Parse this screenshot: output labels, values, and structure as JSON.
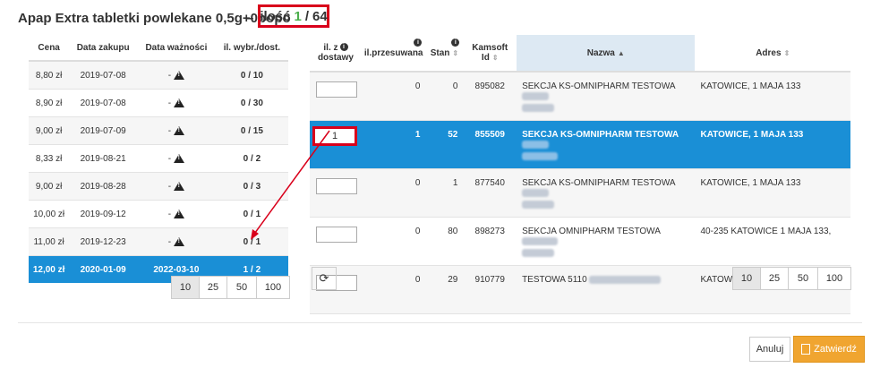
{
  "header": {
    "product": "Apap Extra tabletki powlekane 0,5g+0popo",
    "dash": "–",
    "qty_label": "ilość",
    "qty_selected": "1",
    "qty_sep": "/",
    "qty_total": "64"
  },
  "left": {
    "headers": [
      "Cena",
      "Data zakupu",
      "Data ważności",
      "il. wybr./dost."
    ],
    "rows": [
      {
        "price": "8,80 zł",
        "date": "2019-07-08",
        "exp": "-",
        "qty": "0 / 10"
      },
      {
        "price": "8,90 zł",
        "date": "2019-07-08",
        "exp": "-",
        "qty": "0 / 30"
      },
      {
        "price": "9,00 zł",
        "date": "2019-07-09",
        "exp": "-",
        "qty": "0 / 15"
      },
      {
        "price": "8,33 zł",
        "date": "2019-08-21",
        "exp": "-",
        "qty": "0 / 2"
      },
      {
        "price": "9,00 zł",
        "date": "2019-08-28",
        "exp": "-",
        "qty": "0 / 3"
      },
      {
        "price": "10,00 zł",
        "date": "2019-09-12",
        "exp": "-",
        "qty": "0 / 1"
      },
      {
        "price": "11,00 zł",
        "date": "2019-12-23",
        "exp": "-",
        "qty": "0 / 1"
      },
      {
        "price": "12,00 zł",
        "date": "2020-01-09",
        "exp": "2022-03-10",
        "qty": "1 / 2"
      }
    ],
    "pager": [
      "10",
      "25",
      "50",
      "100"
    ]
  },
  "right": {
    "headers": {
      "il_z_line1": "il. z",
      "il_z_line2": "dostawy",
      "przes": "il.przesuwana",
      "stan": "Stan",
      "kamsoft_line1": "Kamsoft",
      "kamsoft_line2": "Id",
      "nazwa": "Nazwa",
      "adres": "Adres"
    },
    "rows": [
      {
        "input": "",
        "przes": "0",
        "stan": "0",
        "id": "895082",
        "name": "SEKCJA KS-OMNIPHARM TESTOWA",
        "addr": "KATOWICE, 1 MAJA 133"
      },
      {
        "input": "1",
        "przes": "1",
        "stan": "52",
        "id": "855509",
        "name": "SEKCJA KS-OMNIPHARM TESTOWA",
        "addr": "KATOWICE, 1 MAJA 133"
      },
      {
        "input": "",
        "przes": "0",
        "stan": "1",
        "id": "877540",
        "name": "SEKCJA KS-OMNIPHARM TESTOWA",
        "addr": "KATOWICE, 1 MAJA 133"
      },
      {
        "input": "",
        "przes": "0",
        "stan": "80",
        "id": "898273",
        "name": "SEKCJA OMNIPHARM TESTOWA",
        "addr": "40-235 KATOWICE 1 MAJA 133,"
      },
      {
        "input": "",
        "przes": "0",
        "stan": "29",
        "id": "910779",
        "name": "TESTOWA 5110",
        "addr": "KATOWICE, 40-235 KATOWICE,"
      }
    ],
    "pager": [
      "10",
      "25",
      "50",
      "100"
    ]
  },
  "footer": {
    "cancel": "Anuluj",
    "confirm": "Zatwierdź"
  }
}
